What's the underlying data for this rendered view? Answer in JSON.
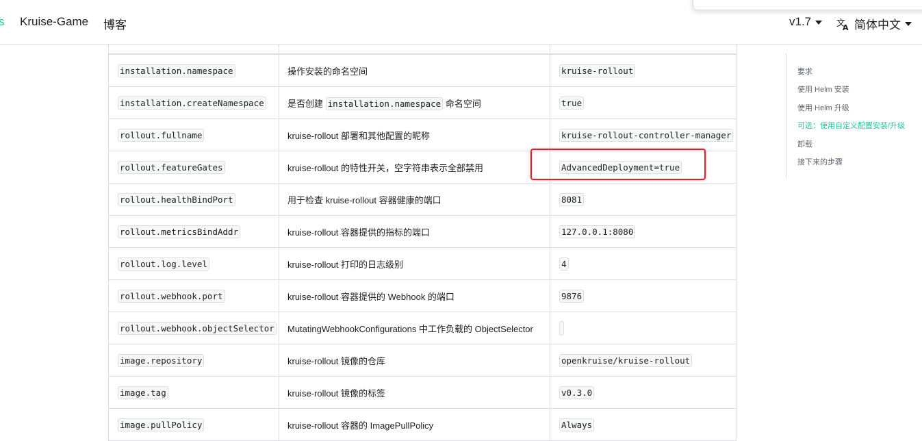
{
  "navbar": {
    "cut_fragment": "s",
    "game_link": "Kruise-Game",
    "blog_link": "博客",
    "version": "v1.7",
    "language": "简体中文",
    "icons": [
      "translate-icon",
      "chevron-down-icon"
    ]
  },
  "table": {
    "rows": [
      {
        "param": "installation.namespace",
        "desc": "操作安装的命名空间",
        "value": "kruise-rollout"
      },
      {
        "param": "installation.createNamespace",
        "desc_pre": "是否创建",
        "desc_code": "installation.namespace",
        "desc_post": "命名空间",
        "value": "true"
      },
      {
        "param": "rollout.fullname",
        "desc": "kruise-rollout 部署和其他配置的昵称",
        "value": "kruise-rollout-controller-manager"
      },
      {
        "param": "rollout.featureGates",
        "desc": "kruise-rollout 的特性开关，空字符串表示全部禁用",
        "value": "AdvancedDeployment=true"
      },
      {
        "param": "rollout.healthBindPort",
        "desc": "用于检查 kruise-rollout 容器健康的端口",
        "value": "8081"
      },
      {
        "param": "rollout.metricsBindAddr",
        "desc": "kruise-rollout 容器提供的指标的端口",
        "value": "127.0.0.1:8080"
      },
      {
        "param": "rollout.log.level",
        "desc": "kruise-rollout 打印的日志级别",
        "value": "4"
      },
      {
        "param": "rollout.webhook.port",
        "desc": "kruise-rollout 容器提供的 Webhook 的端口",
        "value": "9876"
      },
      {
        "param": "rollout.webhook.objectSelector",
        "desc": "MutatingWebhookConfigurations 中工作负载的 ObjectSelector",
        "value": ""
      },
      {
        "param": "image.repository",
        "desc": "kruise-rollout 镜像的仓库",
        "value": "openkruise/kruise-rollout"
      },
      {
        "param": "image.tag",
        "desc": "kruise-rollout 镜像的标签",
        "value": "v0.3.0"
      },
      {
        "param": "image.pullPolicy",
        "desc": "kruise-rollout 容器的 ImagePullPolicy",
        "value": "Always"
      }
    ]
  },
  "toc": {
    "items": [
      {
        "label": "要求"
      },
      {
        "label": "使用 Helm 安装"
      },
      {
        "label": "使用 Helm 升级"
      },
      {
        "label": "可选：使用自定义配置安装/升级",
        "active": true
      },
      {
        "label": "卸载"
      },
      {
        "label": "接下来的步骤"
      }
    ]
  },
  "colors": {
    "accent": "#25c2a0",
    "highlight": "#e0202b",
    "border": "#dadde1"
  }
}
